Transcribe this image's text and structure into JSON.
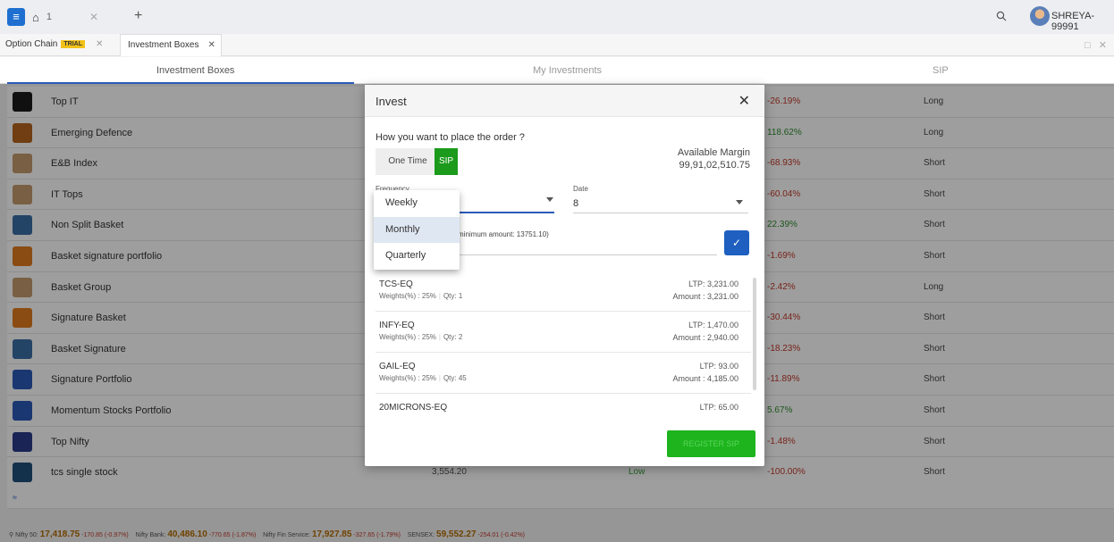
{
  "topbar": {
    "home_tab_number": "1",
    "username": "SHREYA-99991"
  },
  "subtabs": [
    {
      "label": "Option Chain",
      "badge": "TRIAL"
    },
    {
      "label": "Investment Boxes"
    }
  ],
  "section_tabs": [
    "Investment Boxes",
    "My Investments",
    "SIP"
  ],
  "rows": [
    {
      "name": "Top IT",
      "change": "-26.19%",
      "change_color": "#c0392b",
      "type": "Long",
      "thumb": "#1a1a1a"
    },
    {
      "name": "Emerging Defence",
      "change": "118.62%",
      "change_color": "#2e8b2e",
      "type": "Long",
      "thumb": "#b5651d"
    },
    {
      "name": "E&B Index",
      "change": "-68.93%",
      "change_color": "#c0392b",
      "type": "Short",
      "thumb": "#c49a6c"
    },
    {
      "name": "IT Tops",
      "change": "-60.04%",
      "change_color": "#c0392b",
      "type": "Short",
      "thumb": "#c49a6c"
    },
    {
      "name": "Non Split Basket",
      "change": "22.39%",
      "change_color": "#2e8b2e",
      "type": "Short",
      "thumb": "#3b6ea5"
    },
    {
      "name": "Basket signature portfolio",
      "change": "-1.69%",
      "change_color": "#c0392b",
      "type": "Short",
      "thumb": "#e07b1f"
    },
    {
      "name": "Basket Group",
      "change": "-2.42%",
      "change_color": "#c0392b",
      "type": "Long",
      "thumb": "#c49a6c"
    },
    {
      "name": "Signature Basket",
      "change": "-30.44%",
      "change_color": "#c0392b",
      "type": "Short",
      "thumb": "#e07b1f"
    },
    {
      "name": "Basket Signature",
      "change": "-18.23%",
      "change_color": "#c0392b",
      "type": "Short",
      "thumb": "#3b6ea5"
    },
    {
      "name": "Signature Portfolio",
      "change": "-11.89%",
      "change_color": "#c0392b",
      "type": "Short",
      "thumb": "#2a5ab8"
    },
    {
      "name": "Momentum Stocks Portfolio",
      "change": "5.67%",
      "change_color": "#2e8b2e",
      "type": "Short",
      "thumb": "#2a5ab8"
    },
    {
      "name": "Top Nifty",
      "change": "-1.48%",
      "change_color": "#c0392b",
      "type": "Short",
      "thumb": "#2a3a8a"
    },
    {
      "name": "tcs single stock",
      "price": "3,554.20",
      "risk": "Low",
      "change": "-100.00%",
      "change_color": "#c0392b",
      "type": "Short",
      "thumb": "#1f4f7a"
    }
  ],
  "modal": {
    "title": "Invest",
    "question": "How you want to place the order ?",
    "one_time_label": "One Time",
    "sip_label": "SIP",
    "margin_label": "Available Margin",
    "margin_value": "99,91,02,510.75",
    "frequency_label": "Frequency",
    "date_label": "Date",
    "date_value": "8",
    "amount_hint": "minimum amount: 13751.10)",
    "register_label": "REGISTER SIP",
    "holdings": [
      {
        "symbol": "TCS-EQ",
        "weight": "Weights(%) : 25%",
        "qty": "Qty: 1",
        "ltp": "LTP: 3,231.00",
        "amount": "Amount : 3,231.00"
      },
      {
        "symbol": "INFY-EQ",
        "weight": "Weights(%) : 25%",
        "qty": "Qty: 2",
        "ltp": "LTP: 1,470.00",
        "amount": "Amount : 2,940.00"
      },
      {
        "symbol": "GAIL-EQ",
        "weight": "Weights(%) : 25%",
        "qty": "Qty: 45",
        "ltp": "LTP: 93.00",
        "amount": "Amount : 4,185.00"
      },
      {
        "symbol": "20MICRONS-EQ",
        "weight": "",
        "qty": "",
        "ltp": "LTP: 65.00",
        "amount": ""
      }
    ]
  },
  "frequency_dropdown": {
    "options": [
      "Weekly",
      "Monthly",
      "Quarterly"
    ],
    "selected": "Monthly"
  },
  "footer": {
    "nifty50_label": "Nifty 50:",
    "nifty50_value": "17,418.75",
    "nifty50_change": "-170.85 (-0.97%)",
    "banknifty_label": "Nifty Bank:",
    "banknifty_value": "40,486.10",
    "banknifty_change": "-770.65 (-1.87%)",
    "finservice_label": "Nifty Fin Service:",
    "finservice_value": "17,927.85",
    "finservice_change": "-327.65 (-1.79%)",
    "sensex_label": "SENSEX:",
    "sensex_value": "59,552.27",
    "sensex_change": "-254.01 (-0.42%)"
  }
}
